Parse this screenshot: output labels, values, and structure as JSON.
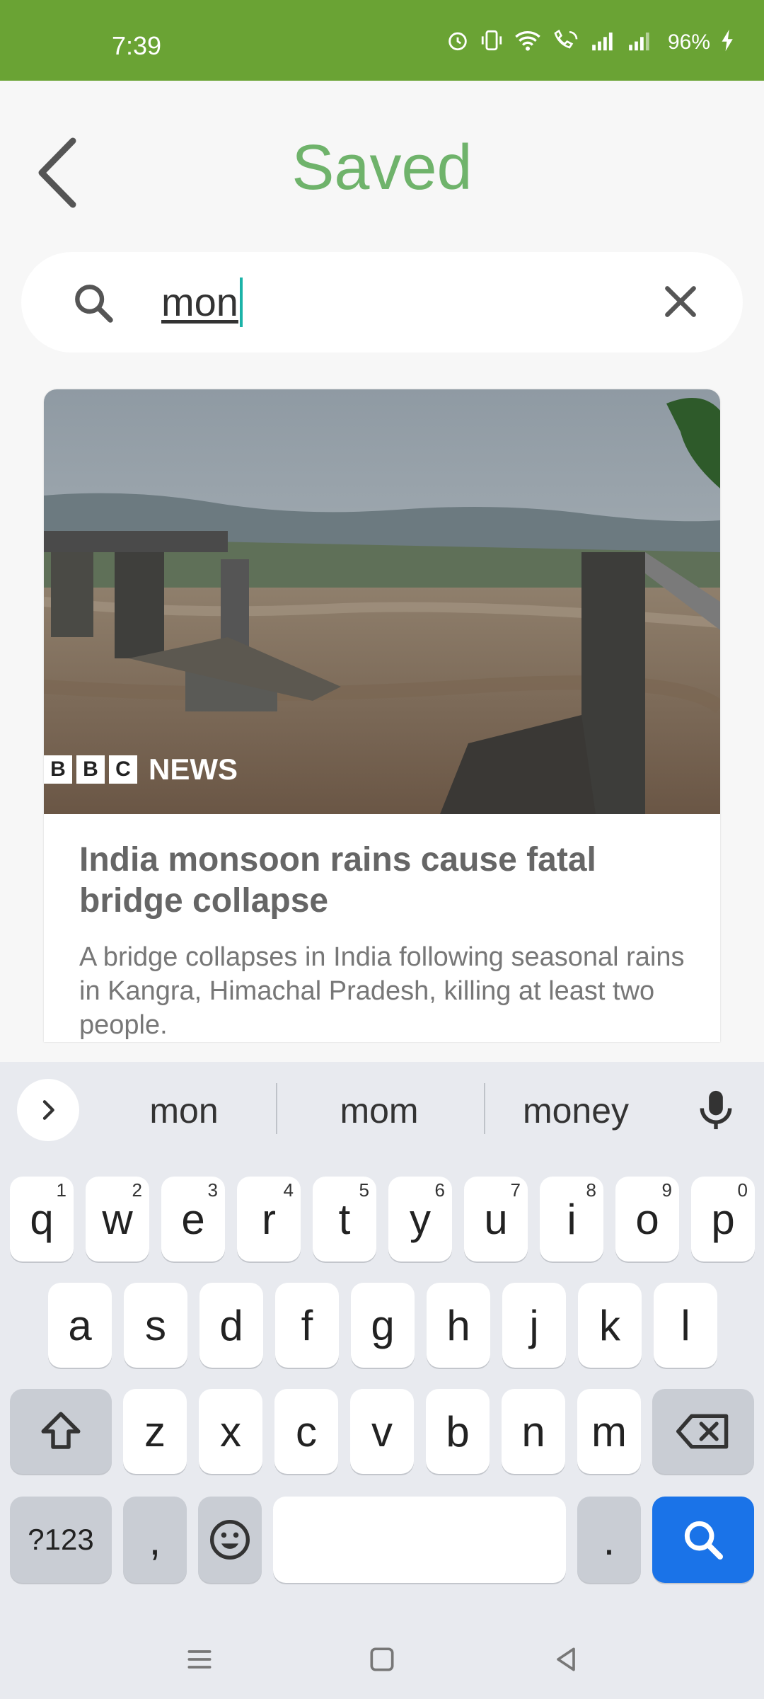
{
  "status_bar": {
    "time": "7:39",
    "battery": "96%",
    "icons": [
      "alarm-icon",
      "vibrate-icon",
      "wifi-icon",
      "wifi-call-icon",
      "signal-icon",
      "signal-icon",
      "charging-icon"
    ]
  },
  "header": {
    "title": "Saved"
  },
  "search": {
    "query": "mon"
  },
  "articles": [
    {
      "source_logo": "B C NEWS",
      "title": "India monsoon rains cause fatal bridge collapse",
      "description": "A bridge collapses in India following seasonal rains in Kangra, Himachal Pradesh, killing at least two people."
    }
  ],
  "keyboard": {
    "suggestions": [
      "mon",
      "mom",
      "money"
    ],
    "row1": [
      "q",
      "w",
      "e",
      "r",
      "t",
      "y",
      "u",
      "i",
      "o",
      "p"
    ],
    "row1_hints": [
      "1",
      "2",
      "3",
      "4",
      "5",
      "6",
      "7",
      "8",
      "9",
      "0"
    ],
    "row2": [
      "a",
      "s",
      "d",
      "f",
      "g",
      "h",
      "j",
      "k",
      "l"
    ],
    "row3": [
      "z",
      "x",
      "c",
      "v",
      "b",
      "n",
      "m"
    ],
    "symbols_label": "?123",
    "comma": ",",
    "period": "."
  },
  "colors": {
    "status_bar": "#6aa334",
    "title": "#6fb36b",
    "accent_blue": "#1a73e8",
    "caret": "#1bb3a8"
  }
}
